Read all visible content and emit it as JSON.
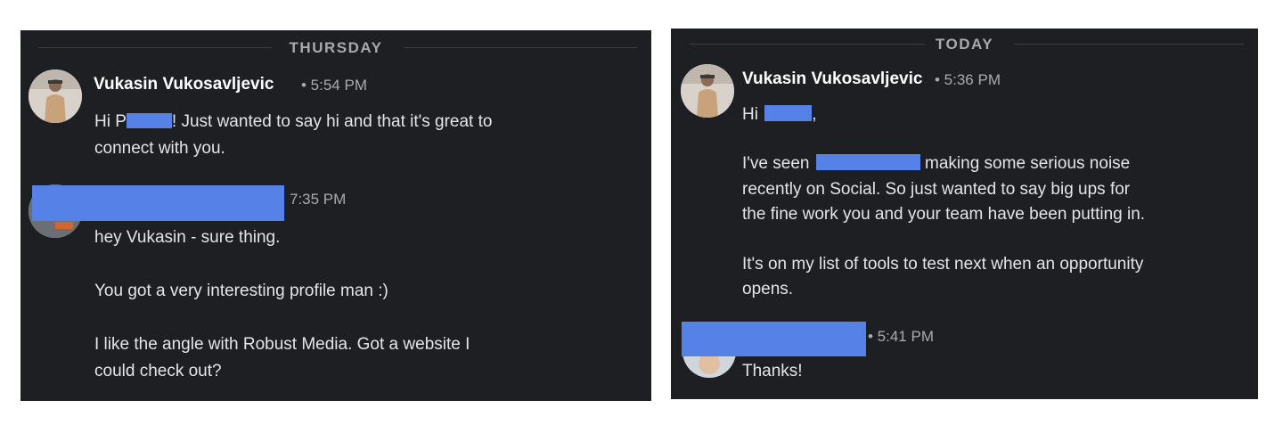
{
  "left_panel": {
    "day_label": "THURSDAY",
    "message1": {
      "sender": "Vukasin Vukosavljevic",
      "time": "• 5:54 PM",
      "greet_prefix": "Hi P",
      "greet_rest": "! Just wanted to say hi and that it's great to",
      "line2": "connect with you."
    },
    "message2": {
      "time": "7:35 PM",
      "line1": "hey Vukasin - sure thing.",
      "line2": "You got a very interesting profile man :)",
      "line3": "I like the angle with Robust Media. Got a website I",
      "line4": "could check out?"
    }
  },
  "right_panel": {
    "day_label": "TODAY",
    "message1": {
      "sender": "Vukasin Vukosavljevic",
      "time": "• 5:36 PM",
      "greet_prefix": "Hi",
      "greet_suffix": ",",
      "p1_prefix": "I've seen",
      "p1_rest": "making some serious noise",
      "p1_line2": "recently on Social. So just wanted to say big ups for",
      "p1_line3": "the fine work you and your team have been putting in.",
      "p2_line1": "It's on my list of tools to test next when an opportunity",
      "p2_line2": "opens."
    },
    "message2": {
      "time": "• 5:41 PM",
      "line1": "Thanks!"
    }
  },
  "colors": {
    "panel_bg": "#1d1f23",
    "redaction": "#5682e8",
    "sender_text": "#ffffff",
    "body_text": "#e4e5e6",
    "meta_text": "#a9abae"
  },
  "icons": [
    "avatar-vukasin",
    "avatar-contact"
  ]
}
